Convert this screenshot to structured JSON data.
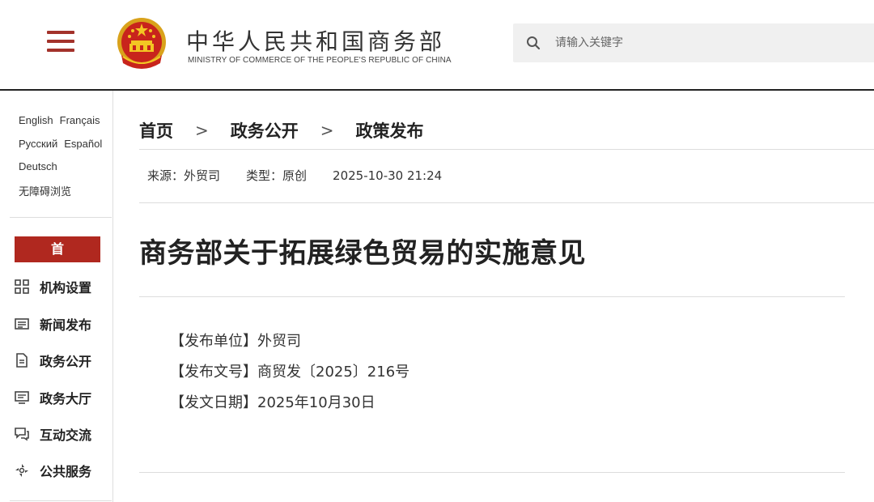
{
  "header": {
    "site_name": "中华人民共和国商务部",
    "site_name_en": "MINISTRY OF COMMERCE OF THE PEOPLE'S REPUBLIC OF CHINA",
    "search_placeholder": "请输入关键字"
  },
  "sidebar": {
    "languages": [
      [
        "English",
        "Français"
      ],
      [
        "Русский",
        "Español"
      ],
      [
        "Deutsch"
      ],
      [
        "无障碍浏览"
      ]
    ],
    "home": "首 页",
    "nav": [
      {
        "label": "机构设置",
        "icon": "org-grid-icon"
      },
      {
        "label": "新闻发布",
        "icon": "news-icon"
      },
      {
        "label": "政务公开",
        "icon": "document-icon"
      },
      {
        "label": "政务大厅",
        "icon": "monitor-icon"
      },
      {
        "label": "互动交流",
        "icon": "chat-icon"
      },
      {
        "label": "公共服务",
        "icon": "service-icon"
      }
    ]
  },
  "breadcrumb": [
    "首页",
    "政务公开",
    "政策发布"
  ],
  "meta": {
    "source": "来源：外贸司",
    "type": "类型：原创",
    "date": "2025-10-30 21:24"
  },
  "article": {
    "title": "商务部关于拓展绿色贸易的实施意见",
    "publisher": "【发布单位】外贸司",
    "doc_number": "【发布文号】商贸发〔2025〕216号",
    "issue_date": "【发文日期】2025年10月30日"
  },
  "colors": {
    "accent": "#b0281f",
    "menu": "#a3322b"
  }
}
